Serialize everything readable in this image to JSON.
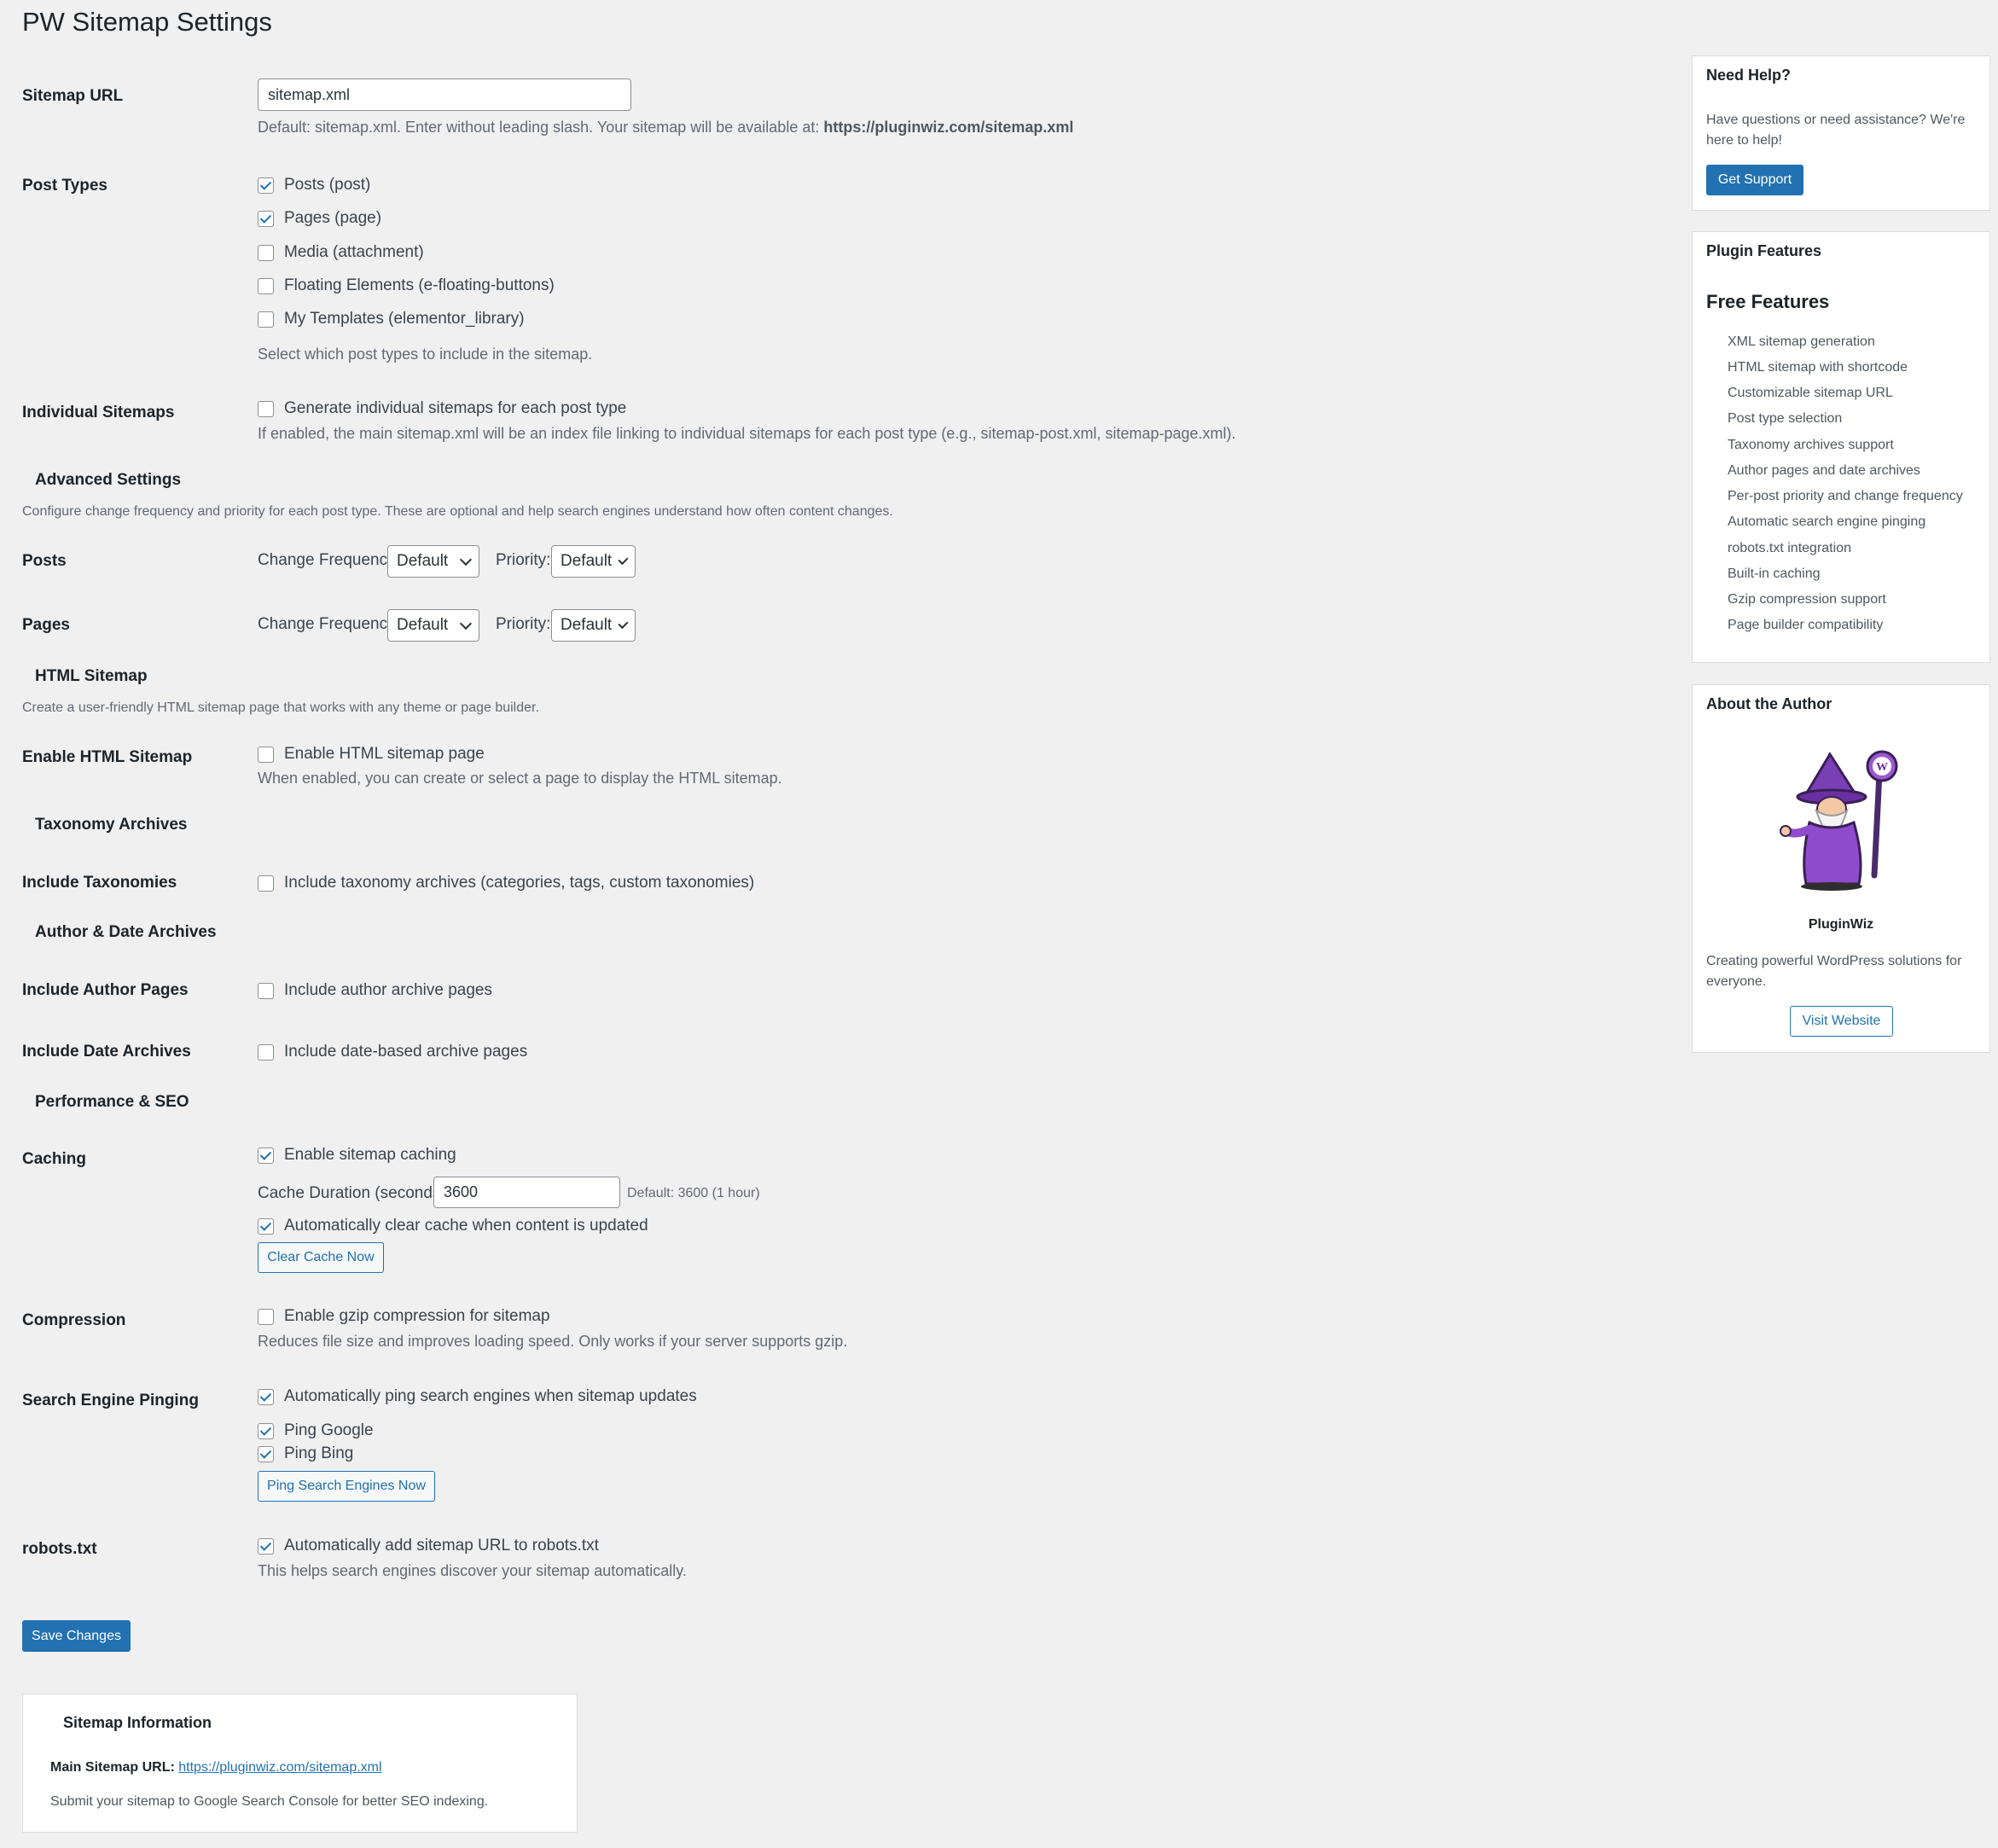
{
  "page": {
    "title": "PW Sitemap Settings"
  },
  "sitemap_url": {
    "label": "Sitemap URL",
    "value": "sitemap.xml",
    "help_prefix": "Default: sitemap.xml. Enter without leading slash. Your sitemap will be available at:",
    "help_url": "https://pluginwiz.com/sitemap.xml"
  },
  "post_types": {
    "label": "Post Types",
    "items": [
      {
        "label": "Posts (post)",
        "checked": true
      },
      {
        "label": "Pages (page)",
        "checked": true
      },
      {
        "label": "Media (attachment)",
        "checked": false
      },
      {
        "label": "Floating Elements (e-floating-buttons)",
        "checked": false
      },
      {
        "label": "My Templates (elementor_library)",
        "checked": false
      }
    ],
    "help": "Select which post types to include in the sitemap."
  },
  "individual": {
    "label": "Individual Sitemaps",
    "checkbox": "Generate individual sitemaps for each post type",
    "checked": false,
    "help": "If enabled, the main sitemap.xml will be an index file linking to individual sitemaps for each post type (e.g., sitemap-post.xml, sitemap-page.xml)."
  },
  "advanced": {
    "heading": "Advanced Settings",
    "desc": "Configure change frequency and priority for each post type. These are optional and help search engines understand how often content changes.",
    "freq_label": "Change Frequency:",
    "priority_label": "Priority:",
    "rows": [
      {
        "label": "Posts",
        "freq": "Default",
        "priority": "Default"
      },
      {
        "label": "Pages",
        "freq": "Default",
        "priority": "Default"
      }
    ]
  },
  "html_sitemap": {
    "heading": "HTML Sitemap",
    "desc": "Create a user-friendly HTML sitemap page that works with any theme or page builder.",
    "label": "Enable HTML Sitemap",
    "checkbox": "Enable HTML sitemap page",
    "checked": false,
    "help": "When enabled, you can create or select a page to display the HTML sitemap."
  },
  "taxonomy": {
    "heading": "Taxonomy Archives",
    "label": "Include Taxonomies",
    "checkbox": "Include taxonomy archives (categories, tags, custom taxonomies)",
    "checked": false
  },
  "author_date": {
    "heading": "Author & Date Archives",
    "author_label": "Include Author Pages",
    "author_checkbox": "Include author archive pages",
    "author_checked": false,
    "date_label": "Include Date Archives",
    "date_checkbox": "Include date-based archive pages",
    "date_checked": false
  },
  "performance": {
    "heading": "Performance & SEO",
    "caching_label": "Caching",
    "caching_checkbox": "Enable sitemap caching",
    "caching_checked": true,
    "duration_label": "Cache Duration (seconds):",
    "duration_value": "3600",
    "duration_help": "Default: 3600 (1 hour)",
    "autoclear_checkbox": "Automatically clear cache when content is updated",
    "autoclear_checked": true,
    "clear_button": "Clear Cache Now",
    "compression_label": "Compression",
    "compression_checkbox": "Enable gzip compression for sitemap",
    "compression_checked": false,
    "compression_help": "Reduces file size and improves loading speed. Only works if your server supports gzip.",
    "ping_label": "Search Engine Pinging",
    "ping_checkbox": "Automatically ping search engines when sitemap updates",
    "ping_checked": true,
    "ping_google": "Ping Google",
    "ping_google_checked": true,
    "ping_bing": "Ping Bing",
    "ping_bing_checked": true,
    "ping_button": "Ping Search Engines Now",
    "robots_label": "robots.txt",
    "robots_checkbox": "Automatically add sitemap URL to robots.txt",
    "robots_checked": true,
    "robots_help": "This helps search engines discover your sitemap automatically."
  },
  "save_button": "Save Changes",
  "info": {
    "title": "Sitemap Information",
    "main_label": "Main Sitemap URL:",
    "main_url": "https://pluginwiz.com/sitemap.xml",
    "note": "Submit your sitemap to Google Search Console for better SEO indexing."
  },
  "sidebar": {
    "help": {
      "title": "Need Help?",
      "text": "Have questions or need assistance? We're here to help!",
      "button": "Get Support"
    },
    "features": {
      "title": "Plugin Features",
      "subtitle": "Free Features",
      "items": [
        "XML sitemap generation",
        "HTML sitemap with shortcode",
        "Customizable sitemap URL",
        "Post type selection",
        "Taxonomy archives support",
        "Author pages and date archives",
        "Per-post priority and change frequency",
        "Automatic search engine pinging",
        "robots.txt integration",
        "Built-in caching",
        "Gzip compression support",
        "Page builder compatibility"
      ]
    },
    "author": {
      "title": "About the Author",
      "name": "PluginWiz",
      "text": "Creating powerful WordPress solutions for everyone.",
      "button": "Visit Website",
      "avatar_icon": "wizard-mascot-icon"
    }
  },
  "colors": {
    "accent": "#2271b1",
    "background": "#f0f0f1",
    "panel": "#ffffff"
  }
}
